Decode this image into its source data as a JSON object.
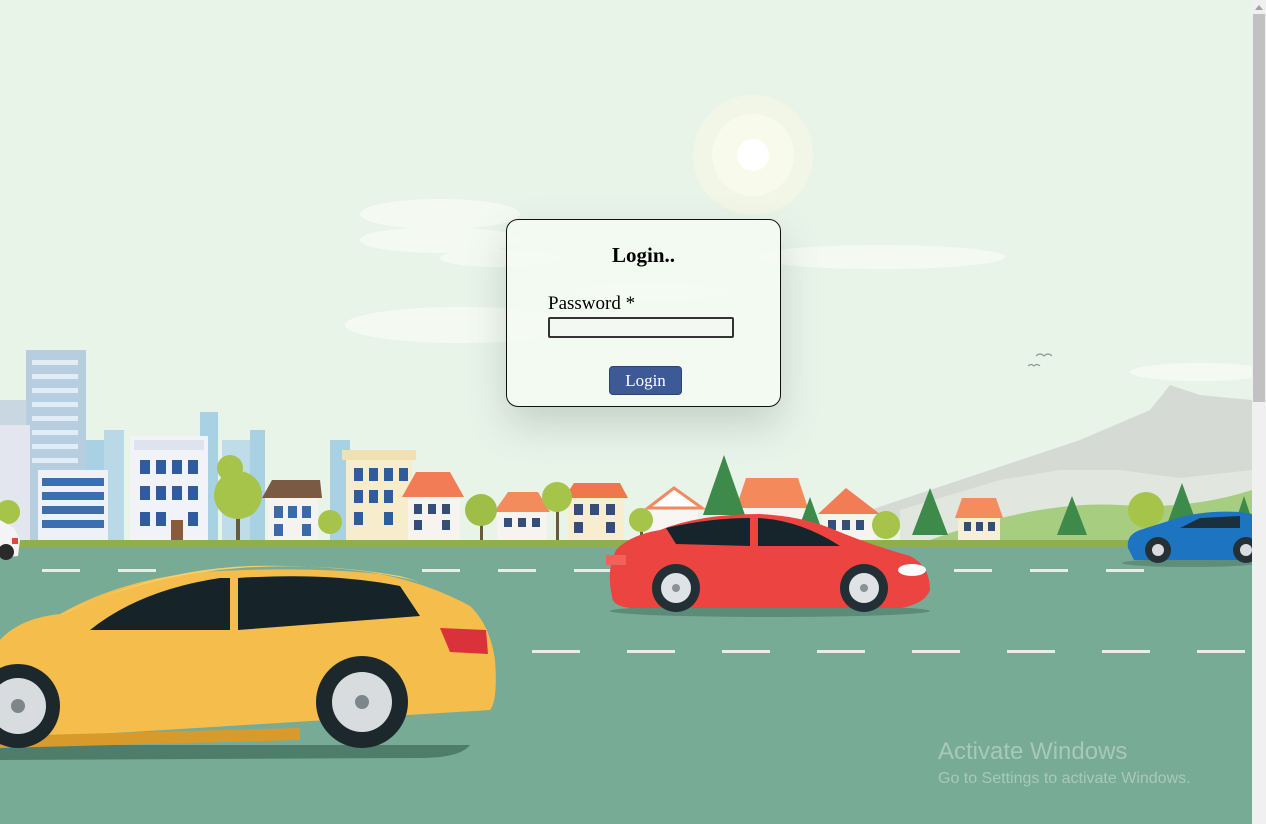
{
  "login": {
    "title": "Login..",
    "password_label": "Password *",
    "password_value": "",
    "button_label": "Login"
  },
  "watermark": {
    "title": "Activate Windows",
    "subtitle": "Go to Settings to activate Windows."
  },
  "colors": {
    "sky": "#e9f4e9",
    "road": "#78ab96",
    "button": "#3e5a96",
    "yellow_car": "#f5be4c",
    "red_car": "#ec4440",
    "blue_car": "#1d74c1"
  }
}
